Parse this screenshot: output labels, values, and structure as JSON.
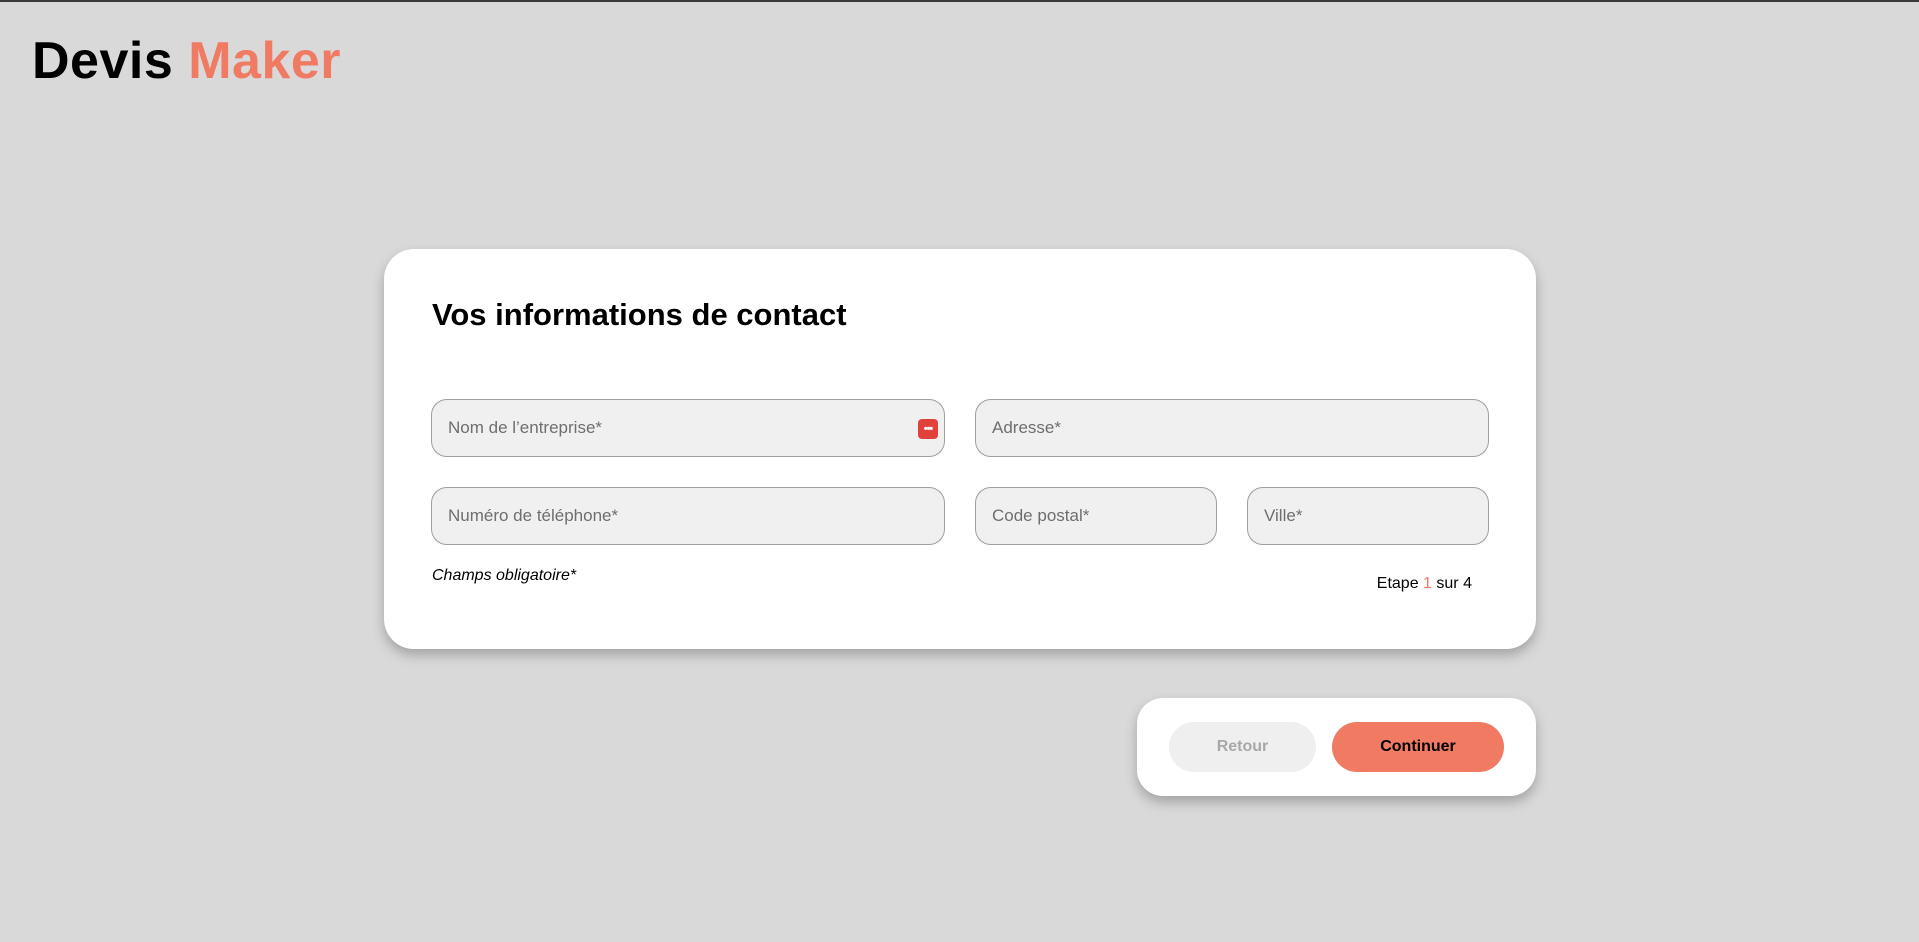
{
  "logo": {
    "part1": "Devis",
    "part2": "Maker"
  },
  "form": {
    "title": "Vos informations de contact",
    "fields": {
      "company": {
        "placeholder": "Nom de l’entreprise*",
        "value": ""
      },
      "address": {
        "placeholder": "Adresse*",
        "value": ""
      },
      "phone": {
        "placeholder": "Numéro de téléphone*",
        "value": ""
      },
      "zip": {
        "placeholder": "Code postal*",
        "value": ""
      },
      "city": {
        "placeholder": "Ville*",
        "value": ""
      }
    },
    "required_note": "Champs obligatoire*",
    "step": {
      "prefix": "Etape",
      "current": "1",
      "middle": "sur",
      "total": "4"
    }
  },
  "actions": {
    "back_label": "Retour",
    "continue_label": "Continuer"
  },
  "icons": {
    "password_manager": "password-manager-icon"
  },
  "colors": {
    "accent": "#f17a63",
    "background": "#d9d9d9",
    "card": "#ffffff",
    "field": "#f0f0f0",
    "password_icon": "#e0413a"
  }
}
